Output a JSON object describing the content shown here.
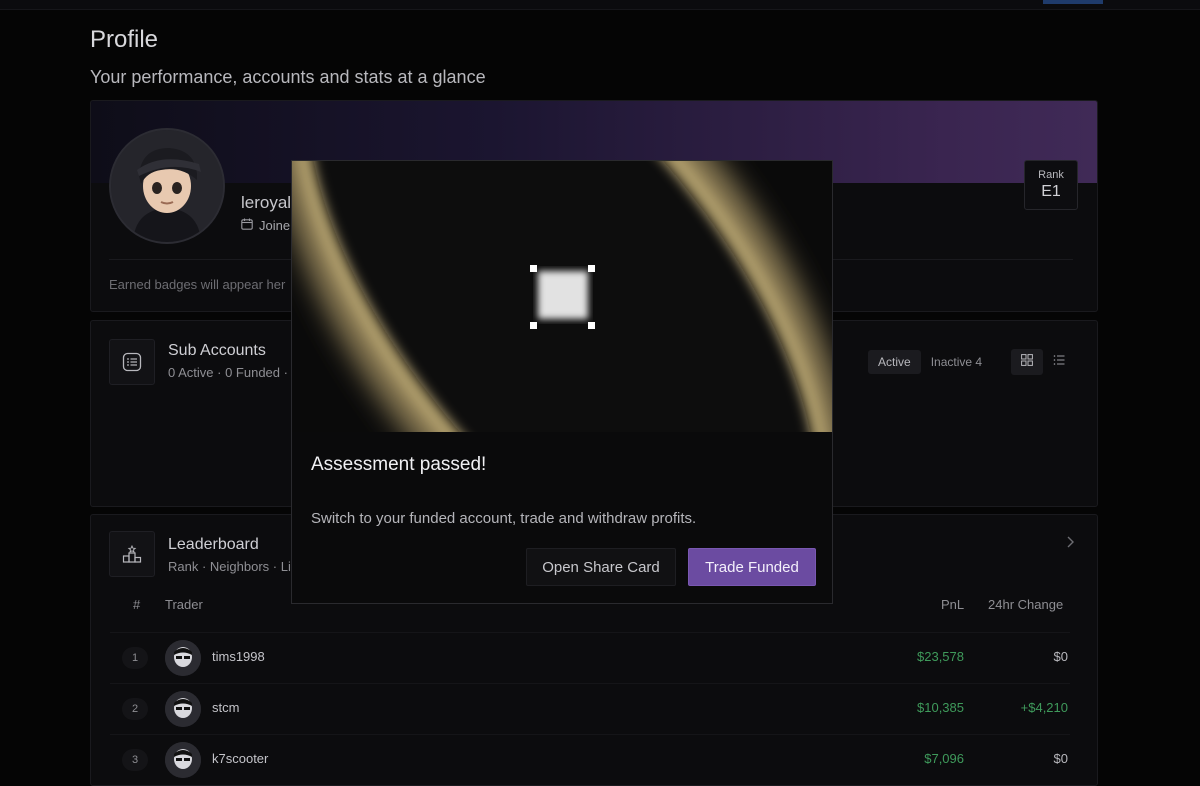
{
  "header": {
    "title": "Profile",
    "subtitle": "Your performance, accounts and stats at a glance"
  },
  "profile": {
    "username": "leroyal",
    "joined_label": "Joine",
    "rank_label": "Rank",
    "rank_value": "E1",
    "badges_note": "Earned badges will appear her"
  },
  "sub_accounts": {
    "title": "Sub Accounts",
    "summary": "0 Active · 0 Funded ·",
    "filter_active": "Active",
    "filter_inactive": "Inactive",
    "inactive_count": "4"
  },
  "leaderboard": {
    "title": "Leaderboard",
    "subtitle": "Rank · Neighbors · Li",
    "columns": {
      "rank": "#",
      "trader": "Trader",
      "pnl": "PnL",
      "change": "24hr Change"
    },
    "rows": [
      {
        "rank": "1",
        "name": "tims1998",
        "pnl": "$23,578",
        "change": "$0"
      },
      {
        "rank": "2",
        "name": "stcm",
        "pnl": "$10,385",
        "change": "+$4,210"
      },
      {
        "rank": "3",
        "name": "k7scooter",
        "pnl": "$7,096",
        "change": "$0"
      }
    ]
  },
  "modal": {
    "title": "Assessment passed!",
    "message": "Switch to your funded account, trade and withdraw profits.",
    "secondary_label": "Open Share Card",
    "primary_label": "Trade Funded"
  },
  "colors": {
    "accent": "#6b4ba1",
    "positive": "#3f9a5b",
    "banner": "#402a57"
  },
  "icons": [
    "calendar-icon",
    "list-icon",
    "podium-icon",
    "grid-icon",
    "chevron-right-icon"
  ]
}
